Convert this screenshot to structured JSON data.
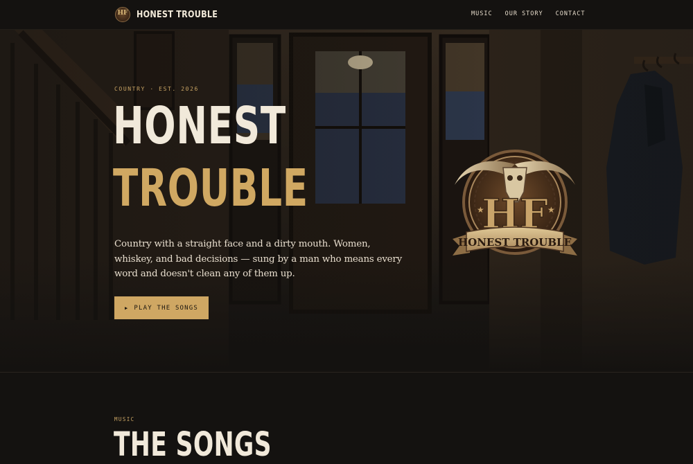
{
  "header": {
    "brand_initials": "HF",
    "brand_name": "HONEST TROUBLE",
    "nav": [
      "MUSIC",
      "OUR STORY",
      "CONTACT"
    ]
  },
  "hero": {
    "eyebrow": "COUNTRY · EST. 2026",
    "title_line1": "HONEST",
    "title_line2": "TROUBLE",
    "lede": "Country with a straight face and a dirty mouth. Women, whiskey, and bad decisions — sung by a man who means every word and doesn't clean any of them up.",
    "cta_label": "PLAY THE SONGS",
    "cta_icon": "play-icon",
    "logo": {
      "monogram": "HF",
      "banner_text": "HONEST TROUBLE"
    }
  },
  "songs": {
    "eyebrow": "MUSIC",
    "title": "THE SONGS"
  },
  "colors": {
    "background": "#141210",
    "accent_gold": "#cfa763",
    "text_cream": "#f1e9da"
  }
}
